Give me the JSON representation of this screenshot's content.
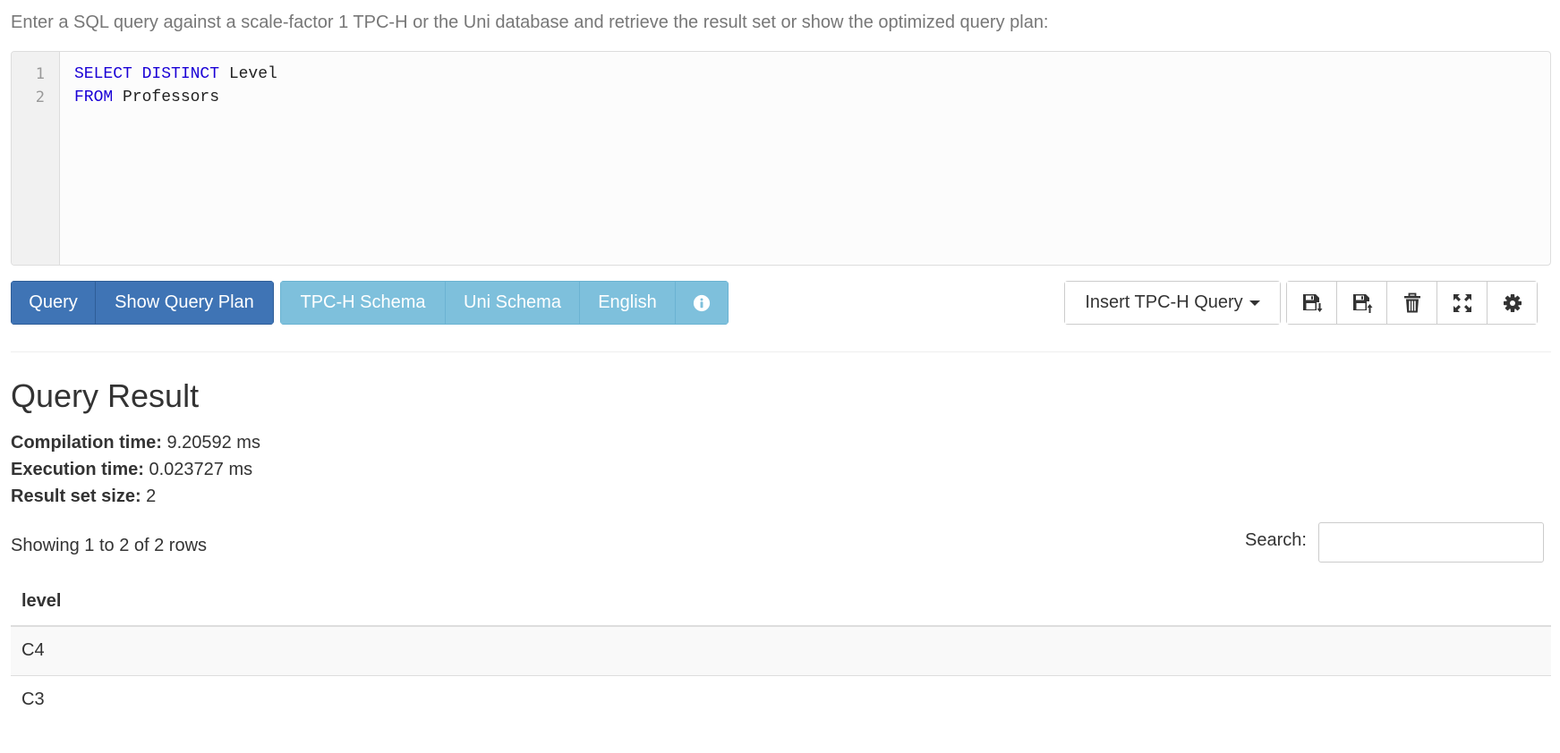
{
  "intro": "Enter a SQL query against a scale-factor 1 TPC-H or the Uni database and retrieve the result set or show the optimized query plan:",
  "editor": {
    "lines": [
      {
        "num": "1",
        "keyword": "SELECT DISTINCT",
        "rest": " Level"
      },
      {
        "num": "2",
        "keyword": "FROM",
        "rest": " Professors"
      }
    ]
  },
  "toolbar": {
    "query_label": "Query",
    "plan_label": "Show Query Plan",
    "tpch_schema_label": "TPC-H Schema",
    "uni_schema_label": "Uni Schema",
    "english_label": "English",
    "insert_label": "Insert TPC-H Query"
  },
  "icons": {
    "info": "info-icon",
    "save_download": "save-download-icon",
    "save_upload": "save-upload-icon",
    "trash": "trash-icon",
    "fullscreen": "fullscreen-icon",
    "settings": "gear-icon"
  },
  "result": {
    "title": "Query Result",
    "compilation_label": "Compilation time:",
    "compilation_value": " 9.20592 ms",
    "execution_label": "Execution time:",
    "execution_value": " 0.023727 ms",
    "size_label": "Result set size:",
    "size_value": " 2",
    "showing": "Showing 1 to 2 of 2 rows",
    "search_label": "Search:",
    "search_value": "",
    "columns": [
      "level"
    ],
    "rows": [
      [
        "C4"
      ],
      [
        "C3"
      ]
    ]
  },
  "colors": {
    "primary": "#3f74b5",
    "info": "#7ec0dc",
    "keyword": "#1a00d6"
  }
}
